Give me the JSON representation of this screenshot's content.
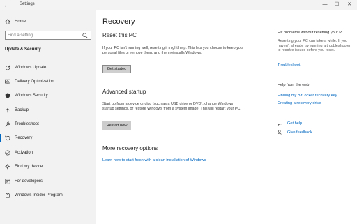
{
  "window": {
    "title": "Settings",
    "back_glyph": "←",
    "minimize_glyph": "—",
    "maximize_glyph": "☐",
    "close_glyph": "✕"
  },
  "sidebar": {
    "home_label": "Home",
    "search_placeholder": "Find a setting",
    "section_title": "Update & Security",
    "items": [
      {
        "label": "Windows Update",
        "icon": "sync-icon"
      },
      {
        "label": "Delivery Optimization",
        "icon": "delivery-optimization-icon"
      },
      {
        "label": "Windows Security",
        "icon": "shield-icon"
      },
      {
        "label": "Backup",
        "icon": "backup-arrow-icon"
      },
      {
        "label": "Troubleshoot",
        "icon": "wrench-icon"
      },
      {
        "label": "Recovery",
        "icon": "recovery-icon",
        "selected": true
      },
      {
        "label": "Activation",
        "icon": "activation-check-icon"
      },
      {
        "label": "Find my device",
        "icon": "find-device-icon"
      },
      {
        "label": "For developers",
        "icon": "developer-tools-icon"
      },
      {
        "label": "Windows Insider Program",
        "icon": "insider-cat-icon"
      }
    ]
  },
  "main": {
    "title": "Recovery",
    "reset": {
      "heading": "Reset this PC",
      "description": "If your PC isn't running well, resetting it might help. This lets you choose to keep your personal files or remove them, and then reinstalls Windows.",
      "button": "Get started"
    },
    "advanced": {
      "heading": "Advanced startup",
      "description": "Start up from a device or disc (such as a USB drive or DVD), change Windows startup settings, or restore Windows from a system image. This will restart your PC.",
      "button": "Restart now"
    },
    "more": {
      "heading": "More recovery options",
      "link": "Learn how to start fresh with a clean installation of Windows"
    }
  },
  "right": {
    "fix_heading": "Fix problems without resetting your PC",
    "fix_text": "Resetting your PC can take a while. If you haven't already, try running a troubleshooter to resolve issues before you reset.",
    "fix_link": "Troubleshoot",
    "web_heading": "Help from the web",
    "web_links": [
      "Finding my BitLocker recovery key",
      "Creating a recovery drive"
    ],
    "get_help": "Get help",
    "give_feedback": "Give feedback"
  },
  "colors": {
    "accent": "#0067c0",
    "sidebar_bg": "#f2f2f2",
    "button_bg": "#cccccc"
  }
}
